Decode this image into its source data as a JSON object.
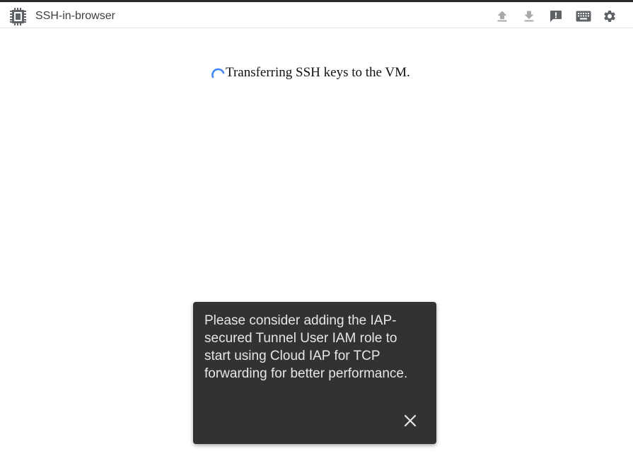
{
  "header": {
    "app_title": "SSH-in-browser",
    "app_icon": "chip-icon",
    "toolbar": [
      {
        "name": "upload-file-button",
        "icon": "upload-icon"
      },
      {
        "name": "download-file-button",
        "icon": "download-icon"
      },
      {
        "name": "send-feedback-button",
        "icon": "feedback-icon"
      },
      {
        "name": "keyboard-button",
        "icon": "keyboard-icon"
      },
      {
        "name": "settings-button",
        "icon": "gear-icon"
      }
    ]
  },
  "main": {
    "status_text": "Transferring SSH keys to the VM.",
    "spinner_color": "#4285f4"
  },
  "toast": {
    "message": "Please consider adding the IAP-secured Tunnel User IAM role to start using Cloud IAP for TCP forwarding for better performance.",
    "close_icon": "close-icon",
    "background": "#323232"
  }
}
